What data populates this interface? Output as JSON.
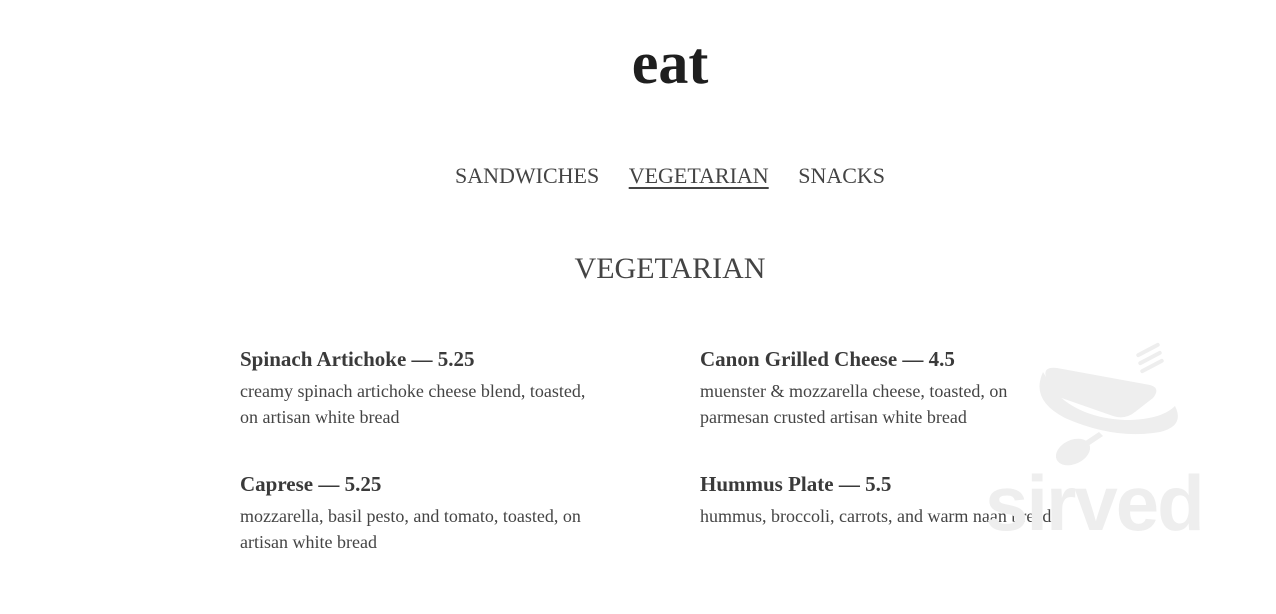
{
  "header": {
    "logo": "eat"
  },
  "nav": {
    "items": [
      {
        "label": "SANDWICHES",
        "active": false
      },
      {
        "label": "VEGETARIAN",
        "active": true
      },
      {
        "label": "SNACKS",
        "active": false
      }
    ]
  },
  "section": {
    "title": "VEGETARIAN"
  },
  "menu_items": [
    {
      "name": "Spinach Artichoke — 5.25",
      "description": "creamy spinach artichoke cheese blend, toasted, on artisan white bread"
    },
    {
      "name": "Canon Grilled Cheese — 4.5",
      "description": "muenster & mozzarella cheese, toasted, on parmesan crusted artisan white bread"
    },
    {
      "name": "Caprese — 5.25",
      "description": "mozzarella, basil pesto, and tomato, toasted, on artisan white bread"
    },
    {
      "name": "Hummus Plate — 5.5",
      "description": "hummus, broccoli, carrots, and warm naan bread"
    }
  ],
  "watermark": {
    "text": "sirved",
    "icon": "knife-fork-spoon-icon",
    "color": "#eeeeee"
  }
}
